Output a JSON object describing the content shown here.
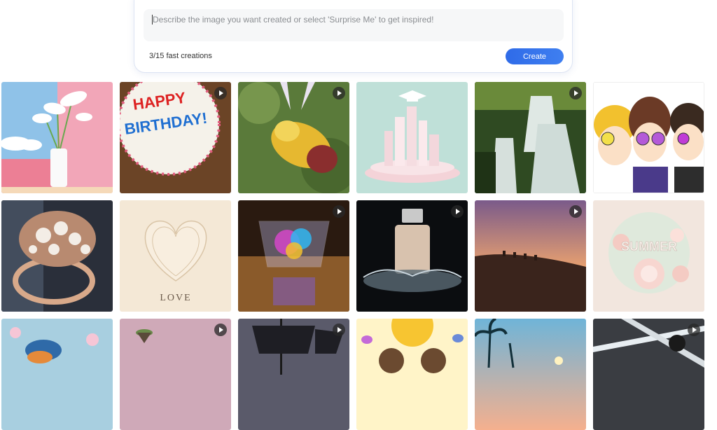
{
  "prompt": {
    "placeholder": "Describe the image you want created or select 'Surprise Me' to get inspired!",
    "counter": "3/15 fast creations",
    "create_label": "Create"
  },
  "gallery": {
    "items": [
      {
        "subject": "calla-lily-vase",
        "video": false
      },
      {
        "subject": "birthday-cake",
        "video": true,
        "text": "HAPPY BIRTHDAY!"
      },
      {
        "subject": "flower-bee",
        "video": true
      },
      {
        "subject": "pastel-city-graduation",
        "video": false
      },
      {
        "subject": "waterfall-forest",
        "video": true
      },
      {
        "subject": "anime-friends",
        "video": false
      },
      {
        "subject": "pearl-ring",
        "video": false
      },
      {
        "subject": "paper-heart",
        "video": false,
        "text": "LOVE"
      },
      {
        "subject": "rainbow-glass",
        "video": true
      },
      {
        "subject": "perfume-bottle",
        "video": true
      },
      {
        "subject": "desert-camels",
        "video": true
      },
      {
        "subject": "summer-paper-flowers",
        "video": false,
        "text": "SUMMER"
      },
      {
        "subject": "bluebird-blossoms",
        "video": false
      },
      {
        "subject": "floating-island",
        "video": true
      },
      {
        "subject": "pirate-ship",
        "video": true
      },
      {
        "subject": "sun-butterflies",
        "video": false
      },
      {
        "subject": "palm-sunset",
        "video": false
      },
      {
        "subject": "light-rays-figures",
        "video": true
      }
    ]
  }
}
